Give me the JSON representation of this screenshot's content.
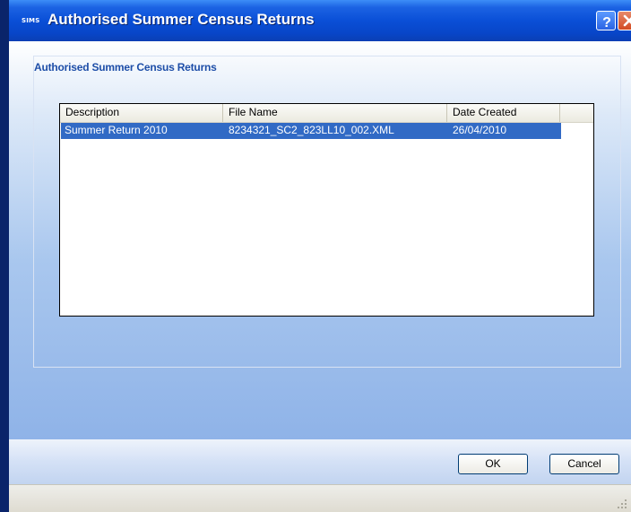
{
  "window": {
    "app_badge": "SIMS",
    "title": "Authorised Summer Census Returns",
    "help_label": "?",
    "close_label": "X"
  },
  "group": {
    "title": "Authorised Summer Census Returns"
  },
  "table": {
    "columns": [
      "Description",
      "File Name",
      "Date Created"
    ],
    "rows": [
      {
        "description": "Summer Return 2010",
        "file_name": "8234321_SC2_823LL10_002.XML",
        "date_created": "26/04/2010",
        "selected": true
      }
    ]
  },
  "buttons": {
    "ok": "OK",
    "cancel": "Cancel"
  },
  "colors": {
    "title_bar": "#0a4fd7",
    "selection": "#316ac5",
    "group_title": "#1e4ea8"
  }
}
